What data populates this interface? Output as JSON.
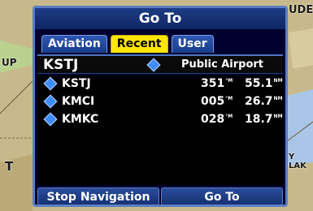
{
  "map": {
    "labels": [
      "UP",
      "UDE",
      "T",
      "Y LAK"
    ]
  },
  "dialog": {
    "title": "Go To",
    "tabs": [
      {
        "label": "Aviation",
        "active": false
      },
      {
        "label": "Recent",
        "active": true
      },
      {
        "label": "User",
        "active": false
      }
    ],
    "selected": {
      "ident": "KSTJ",
      "type": "Public Airport",
      "icon": "airport-diamond-icon"
    },
    "rows": [
      {
        "ident": "KSTJ",
        "bearing": "351",
        "bearing_unit": "°M",
        "distance": "55.1",
        "distance_unit": "NM",
        "icon": "airport-diamond-icon"
      },
      {
        "ident": "KMCI",
        "bearing": "005",
        "bearing_unit": "°M",
        "distance": "26.7",
        "distance_unit": "NM",
        "icon": "airport-diamond-icon"
      },
      {
        "ident": "KMKC",
        "bearing": "028",
        "bearing_unit": "°M",
        "distance": "18.7",
        "distance_unit": "NM",
        "icon": "airport-diamond-icon"
      }
    ],
    "buttons": {
      "stop_navigation": "Stop Navigation",
      "go_to": "Go To"
    }
  },
  "colors": {
    "highlight_tab": "#ffe600",
    "dialog_bg": "#00002e",
    "accent_blue": "#3f8cff"
  }
}
